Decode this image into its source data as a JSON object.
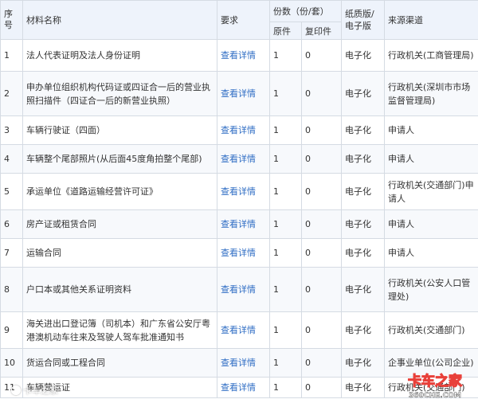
{
  "headers": {
    "seq": "序号",
    "name": "材料名称",
    "req": "要求",
    "copies": "份数（份/套）",
    "original": "原件",
    "copy": "复印件",
    "format": "纸质版/电子版",
    "source": "来源渠道"
  },
  "rows": [
    {
      "seq": "1",
      "name": "法人代表证明及法人身份证明",
      "req": "查看详情",
      "original": "1",
      "copy": "0",
      "format": "电子化",
      "source": "行政机关(工商管理局)"
    },
    {
      "seq": "2",
      "name": "申办单位组织机构代码证或四证合一后的营业执照扫描件（四证合一后的新营业执照）",
      "req": "查看详情",
      "original": "1",
      "copy": "0",
      "format": "电子化",
      "source": "行政机关(深圳市市场监督管理局)"
    },
    {
      "seq": "3",
      "name": "车辆行驶证（四面）",
      "req": "查看详情",
      "original": "1",
      "copy": "0",
      "format": "电子化",
      "source": "申请人"
    },
    {
      "seq": "4",
      "name": "车辆整个尾部照片(从后面45度角拍整个尾部)",
      "req": "查看详情",
      "original": "1",
      "copy": "0",
      "format": "电子化",
      "source": "申请人"
    },
    {
      "seq": "5",
      "name": "承运单位《道路运输经营许可证》",
      "req": "查看详情",
      "original": "1",
      "copy": "0",
      "format": "电子化",
      "source": "行政机关(交通部门)申请人"
    },
    {
      "seq": "6",
      "name": "房产证或租赁合同",
      "req": "查看详情",
      "original": "1",
      "copy": "0",
      "format": "电子化",
      "source": "申请人"
    },
    {
      "seq": "7",
      "name": "运输合同",
      "req": "查看详情",
      "original": "1",
      "copy": "0",
      "format": "电子化",
      "source": "申请人"
    },
    {
      "seq": "8",
      "name": "户口本或其他关系证明资料",
      "req": "查看详情",
      "original": "1",
      "copy": "0",
      "format": "电子化",
      "source": "行政机关(公安人口管理处)"
    },
    {
      "seq": "9",
      "name": "海关进出口登记簿（司机本）和广东省公安厅粤港澳机动车往来及驾驶人驾车批准通知书",
      "req": "查看详情",
      "original": "1",
      "copy": "0",
      "format": "电子化",
      "source": "行政机关(交通部门)"
    },
    {
      "seq": "10",
      "name": "货运合同或工程合同",
      "req": "查看详情",
      "original": "1",
      "copy": "0",
      "format": "电子化",
      "source": "企事业单位(公司企业)"
    },
    {
      "seq": "11",
      "name": "车辆营运证",
      "req": "查看详情",
      "original": "1",
      "copy": "0",
      "format": "电子化",
      "source": "行政机关(交通部门)"
    }
  ],
  "watermark": {
    "left": "卡车之家",
    "right_top": "卡车之家",
    "right_bottom": "360CHE.COM"
  }
}
